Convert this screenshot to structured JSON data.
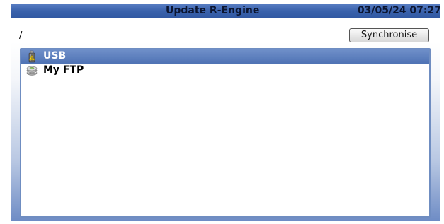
{
  "window": {
    "title": "Update R-Engine",
    "datetime": "03/05/24 07:27"
  },
  "toolbar": {
    "path": "/",
    "sync_label": "Synchronise"
  },
  "list": {
    "items": [
      {
        "label": "USB",
        "icon": "usb-drive-icon",
        "selected": true
      },
      {
        "label": "My FTP",
        "icon": "ftp-server-icon",
        "selected": false
      }
    ]
  },
  "colors": {
    "titlebar": "#3b63ad",
    "selection": "#5b7fbf",
    "list_border": "#6f8dc1"
  }
}
